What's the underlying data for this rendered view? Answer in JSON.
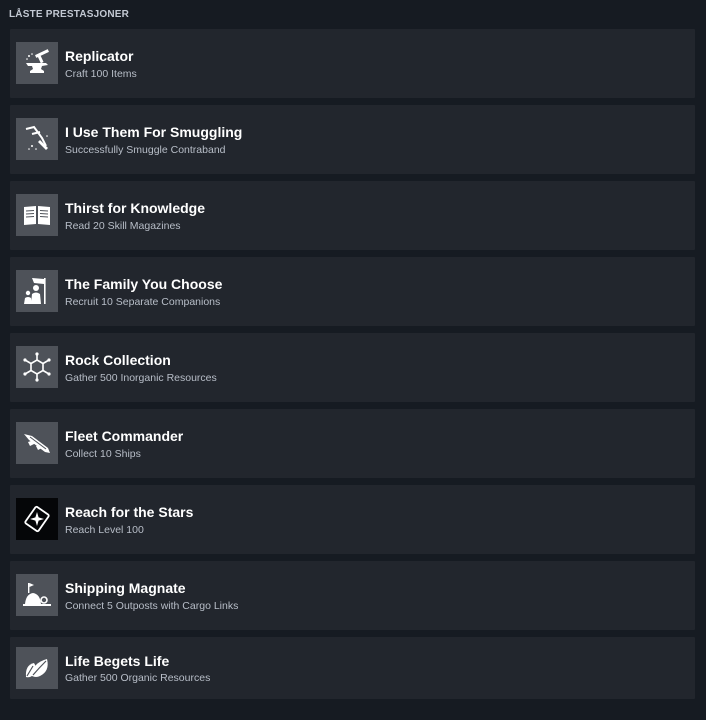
{
  "header": {
    "title": "LÅSTE PRESTASJONER"
  },
  "achievements": [
    {
      "title": "Replicator",
      "description": "Craft 100 Items",
      "icon": "anvil-icon"
    },
    {
      "title": "I Use Them For Smuggling",
      "description": "Successfully Smuggle Contraband",
      "icon": "smuggle-icon"
    },
    {
      "title": "Thirst for Knowledge",
      "description": "Read 20 Skill Magazines",
      "icon": "book-icon"
    },
    {
      "title": "The Family You Choose",
      "description": "Recruit 10 Separate Companions",
      "icon": "companions-icon"
    },
    {
      "title": "Rock Collection",
      "description": "Gather 500 Inorganic Resources",
      "icon": "hexagon-molecule-icon"
    },
    {
      "title": "Fleet Commander",
      "description": "Collect 10 Ships",
      "icon": "ship-icon"
    },
    {
      "title": "Reach for the Stars",
      "description": "Reach Level 100",
      "icon": "star-card-icon"
    },
    {
      "title": "Shipping Magnate",
      "description": "Connect 5 Outposts with Cargo Links",
      "icon": "outpost-icon"
    },
    {
      "title": "Life Begets Life",
      "description": "Gather 500 Organic Resources",
      "icon": "leaf-icon"
    }
  ]
}
